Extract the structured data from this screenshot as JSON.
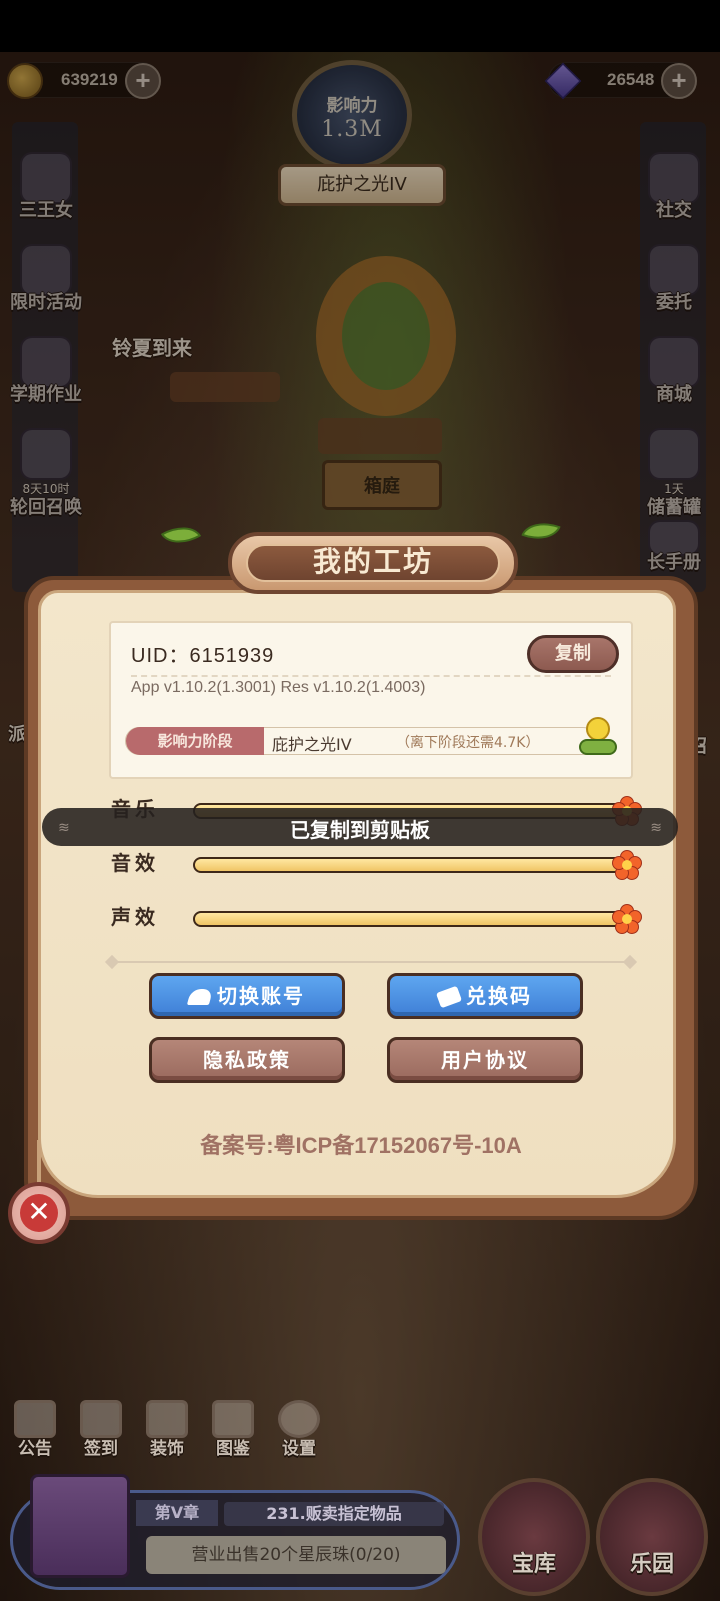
{
  "top_bar": {
    "gold": "639219",
    "gems": "26548",
    "influence_label": "影响力",
    "influence_value": "1.3M",
    "stage_ribbon": "庇护之光IV"
  },
  "left_menu": [
    {
      "label": "三王女",
      "icon": "princess-icon"
    },
    {
      "label": "限时活动",
      "icon": "event-icon"
    },
    {
      "label": "学期作业",
      "icon": "homework-icon"
    },
    {
      "label": "轮回召唤",
      "icon": "summon-icon",
      "timer": "8天10时"
    }
  ],
  "right_menu": [
    {
      "label": "社交",
      "icon": "social-icon"
    },
    {
      "label": "委托",
      "icon": "commission-icon"
    },
    {
      "label": "商城",
      "icon": "shop-icon"
    },
    {
      "label": "储蓄罐",
      "icon": "piggy-bank-icon",
      "timer": "1天"
    },
    {
      "label": "长手册",
      "icon": "handbook-icon"
    }
  ],
  "scene": {
    "event_label": "铃夏到来",
    "sign_label": "箱庭",
    "edge_left": "派",
    "edge_right": "召"
  },
  "dialog": {
    "title": "我的工坊",
    "uid": "UID：6151939",
    "copy_label": "复制",
    "version": "App v1.10.2(1.3001)   Res v1.10.2(1.4003)",
    "stage_tag": "影响力阶段",
    "stage_name": "庇护之光IV",
    "stage_need": "（离下阶段还需4.7K）",
    "sliders": [
      {
        "label": "音乐",
        "value": 1.0
      },
      {
        "label": "音效",
        "value": 1.0
      },
      {
        "label": "声效",
        "value": 1.0
      }
    ],
    "switch_account": "切换账号",
    "redeem_code": "兑换码",
    "privacy": "隐私政策",
    "user_agreement": "用户协议",
    "icp": "备案号:粤ICP备17152067号-10A"
  },
  "toast": "已复制到剪贴板",
  "bottom_nav": [
    {
      "label": "公告",
      "icon": "notice-icon"
    },
    {
      "label": "签到",
      "icon": "calendar-icon"
    },
    {
      "label": "装饰",
      "icon": "decor-icon"
    },
    {
      "label": "图鉴",
      "icon": "book-icon"
    },
    {
      "label": "设置",
      "icon": "gear-icon"
    }
  ],
  "quest": {
    "chapter": "第V章",
    "title": "231.贩卖指定物品",
    "desc": "营业出售20个星辰珠(0/20)"
  },
  "bottom_right": [
    {
      "label": "宝库",
      "icon": "treasury-icon"
    },
    {
      "label": "乐园",
      "icon": "paradise-icon"
    }
  ],
  "colors": {
    "accent_blue": "#3f7fd6",
    "accent_mauve": "#9a6a5e",
    "panel": "#f3e6cb",
    "frame": "#8d5a3b"
  }
}
